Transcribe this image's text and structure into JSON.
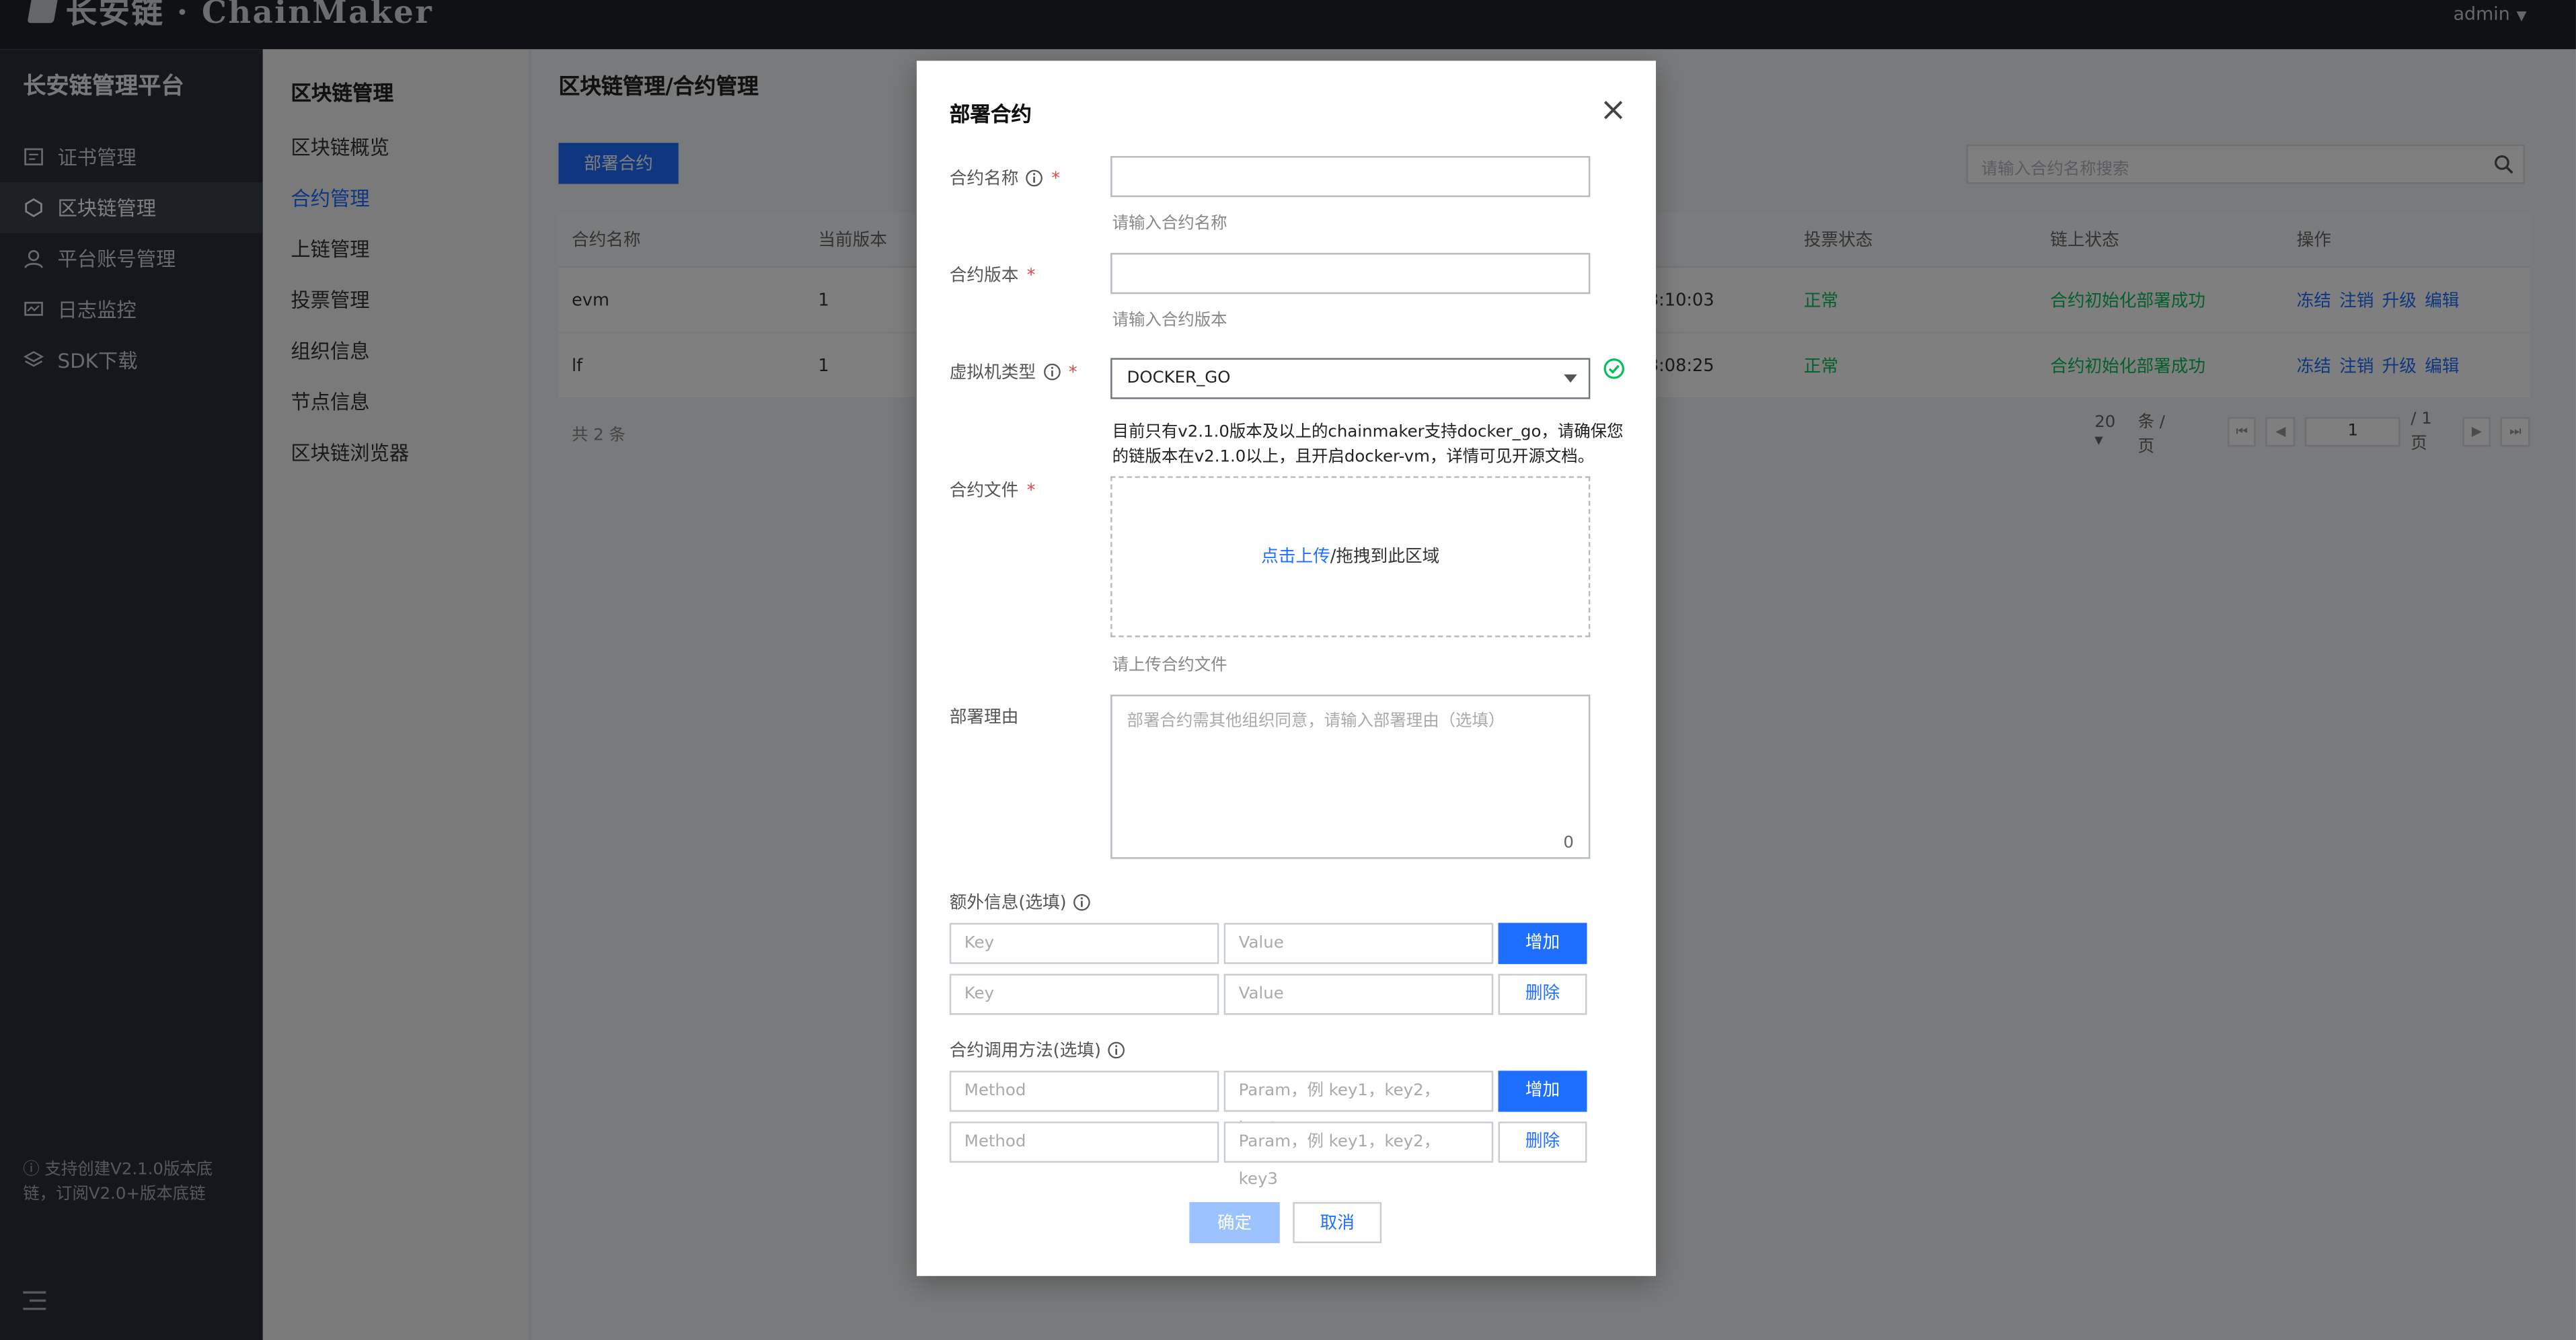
{
  "topbar": {
    "brand": "长安链 · ChainMaker",
    "user": "admin"
  },
  "sidebar": {
    "platform_title": "长安链管理平台",
    "items": [
      {
        "label": "证书管理",
        "icon": "certificate-icon"
      },
      {
        "label": "区块链管理",
        "icon": "chain-icon"
      },
      {
        "label": "平台账号管理",
        "icon": "user-icon"
      },
      {
        "label": "日志监控",
        "icon": "monitor-icon"
      },
      {
        "label": "SDK下载",
        "icon": "layers-icon"
      }
    ],
    "note": "支持创建V2.1.0版本底链，订阅V2.0+版本底链"
  },
  "submenu": {
    "title": "区块链管理",
    "items": [
      "区块链概览",
      "合约管理",
      "上链管理",
      "投票管理",
      "组织信息",
      "节点信息",
      "区块链浏览器"
    ]
  },
  "main": {
    "breadcrumb": "区块链管理/合约管理",
    "deploy_button": "部署合约",
    "search_placeholder": "请输入合约名称搜索",
    "columns": [
      "合约名称",
      "当前版本",
      "投票状态",
      "链上状态",
      "操作"
    ],
    "rows": [
      {
        "name": "evm",
        "version": "1",
        "time": "3:10:03",
        "vote": "正常",
        "chain_status": "合约初始化部署成功",
        "actions": [
          "冻结",
          "注销",
          "升级",
          "编辑"
        ]
      },
      {
        "name": "lf",
        "version": "1",
        "time": "3:08:25",
        "vote": "正常",
        "chain_status": "合约初始化部署成功",
        "actions": [
          "冻结",
          "注销",
          "升级",
          "编辑"
        ]
      }
    ],
    "total": "共 2 条",
    "page_size": "20",
    "per_page": "条 / 页",
    "page": "1",
    "page_total": "/ 1 页"
  },
  "modal": {
    "title": "部署合约",
    "name_label": "合约名称",
    "name_help": "请输入合约名称",
    "version_label": "合约版本",
    "version_help": "请输入合约版本",
    "vm_label": "虚拟机类型",
    "vm_value": "DOCKER_GO",
    "vm_notice": "目前只有v2.1.0版本及以上的chainmaker支持docker_go，请确保您的链版本在v2.1.0以上，且开启docker-vm，详情可见开源文档。",
    "file_label": "合约文件",
    "upload_link": "点击上传",
    "upload_text": "/拖拽到此区域",
    "file_help": "请上传合约文件",
    "reason_label": "部署理由",
    "reason_placeholder": "部署合约需其他组织同意，请输入部署理由（选填）",
    "reason_count": "0",
    "extra_label": "额外信息(选填)",
    "key_placeholder": "Key",
    "value_placeholder": "Value",
    "add_label": "增加",
    "delete_label": "删除",
    "method_label": "合约调用方法(选填)",
    "method_placeholder": "Method",
    "param_placeholder": "Param，例 key1，key2，key3",
    "confirm_label": "确定",
    "cancel_label": "取消"
  }
}
